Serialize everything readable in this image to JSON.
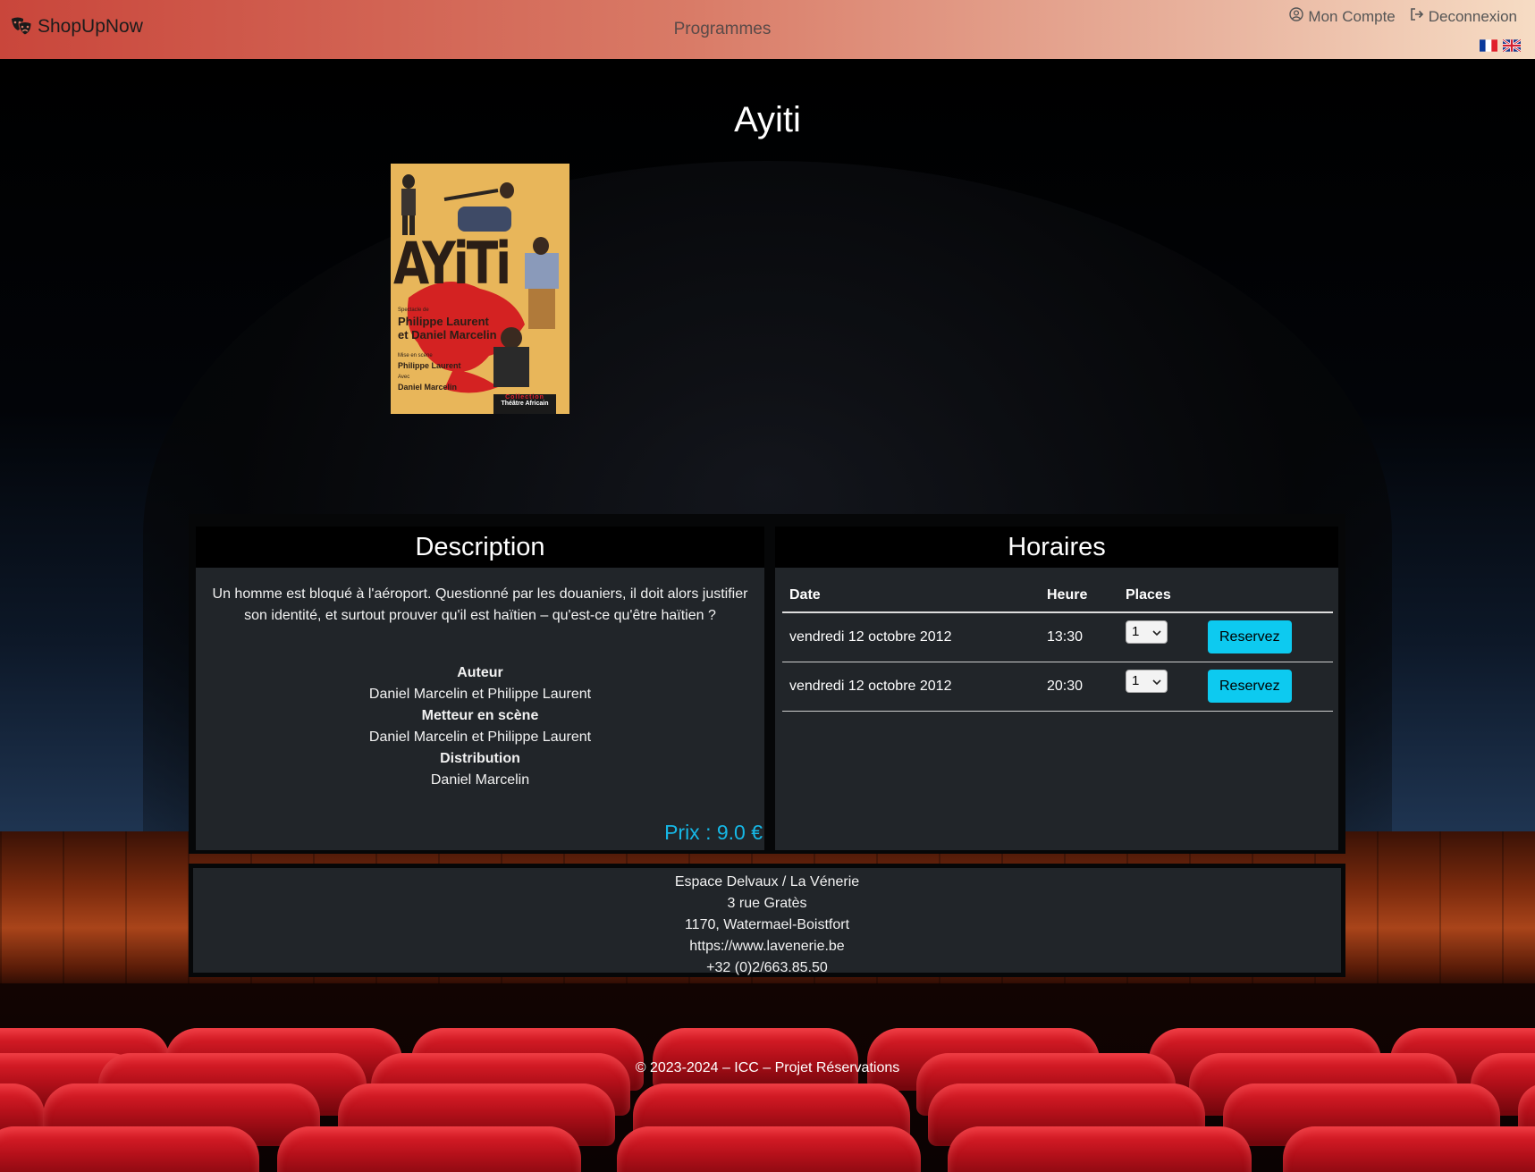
{
  "nav": {
    "brand": "ShopUpNow",
    "center_link": "Programmes",
    "account": "Mon Compte",
    "logout": "Deconnexion",
    "flags": [
      "fr-flag",
      "uk-flag"
    ]
  },
  "show": {
    "title": "Ayiti",
    "poster": {
      "title": "AYiTi",
      "line1": "Spectacle de",
      "line2": "Philippe Laurent",
      "line3": "et Daniel Marcelin",
      "line4": "Mise en scène",
      "line5": "Philippe Laurent",
      "line6": "Avec",
      "line7": "Daniel Marcelin",
      "line8": "Collection",
      "line9": "Théâtre Africain"
    }
  },
  "description": {
    "heading": "Description",
    "text": "Un homme est bloqué à l'aéroport. Questionné par les douaniers, il doit alors justifier son identité, et surtout prouver qu'il est haïtien – qu'est-ce qu'être haïtien ?",
    "author_label": "Auteur",
    "author": "Daniel Marcelin et Philippe Laurent",
    "director_label": "Metteur en scène",
    "director": "Daniel Marcelin et Philippe Laurent",
    "cast_label": "Distribution",
    "cast": "Daniel Marcelin",
    "price": "Prix : 9.0 €"
  },
  "schedule": {
    "heading": "Horaires",
    "headers": {
      "date": "Date",
      "time": "Heure",
      "places": "Places"
    },
    "rows": [
      {
        "date": "vendredi 12 octobre 2012",
        "time": "13:30",
        "places": "1",
        "button": "Reservez"
      },
      {
        "date": "vendredi 12 octobre 2012",
        "time": "20:30",
        "places": "1",
        "button": "Reservez"
      }
    ]
  },
  "venue": {
    "name": "Espace Delvaux / La Vénerie",
    "street": "3 rue Gratès",
    "city": "1170, Watermael-Boistfort",
    "website": "https://www.lavenerie.be",
    "phone": "+32 (0)2/663.85.50"
  },
  "footer": {
    "text": "© 2023-2024 – ICC – Projet Réservations"
  },
  "colors": {
    "accent": "#0dcaf0",
    "price": "#16b8e6",
    "panel": "#212529"
  }
}
